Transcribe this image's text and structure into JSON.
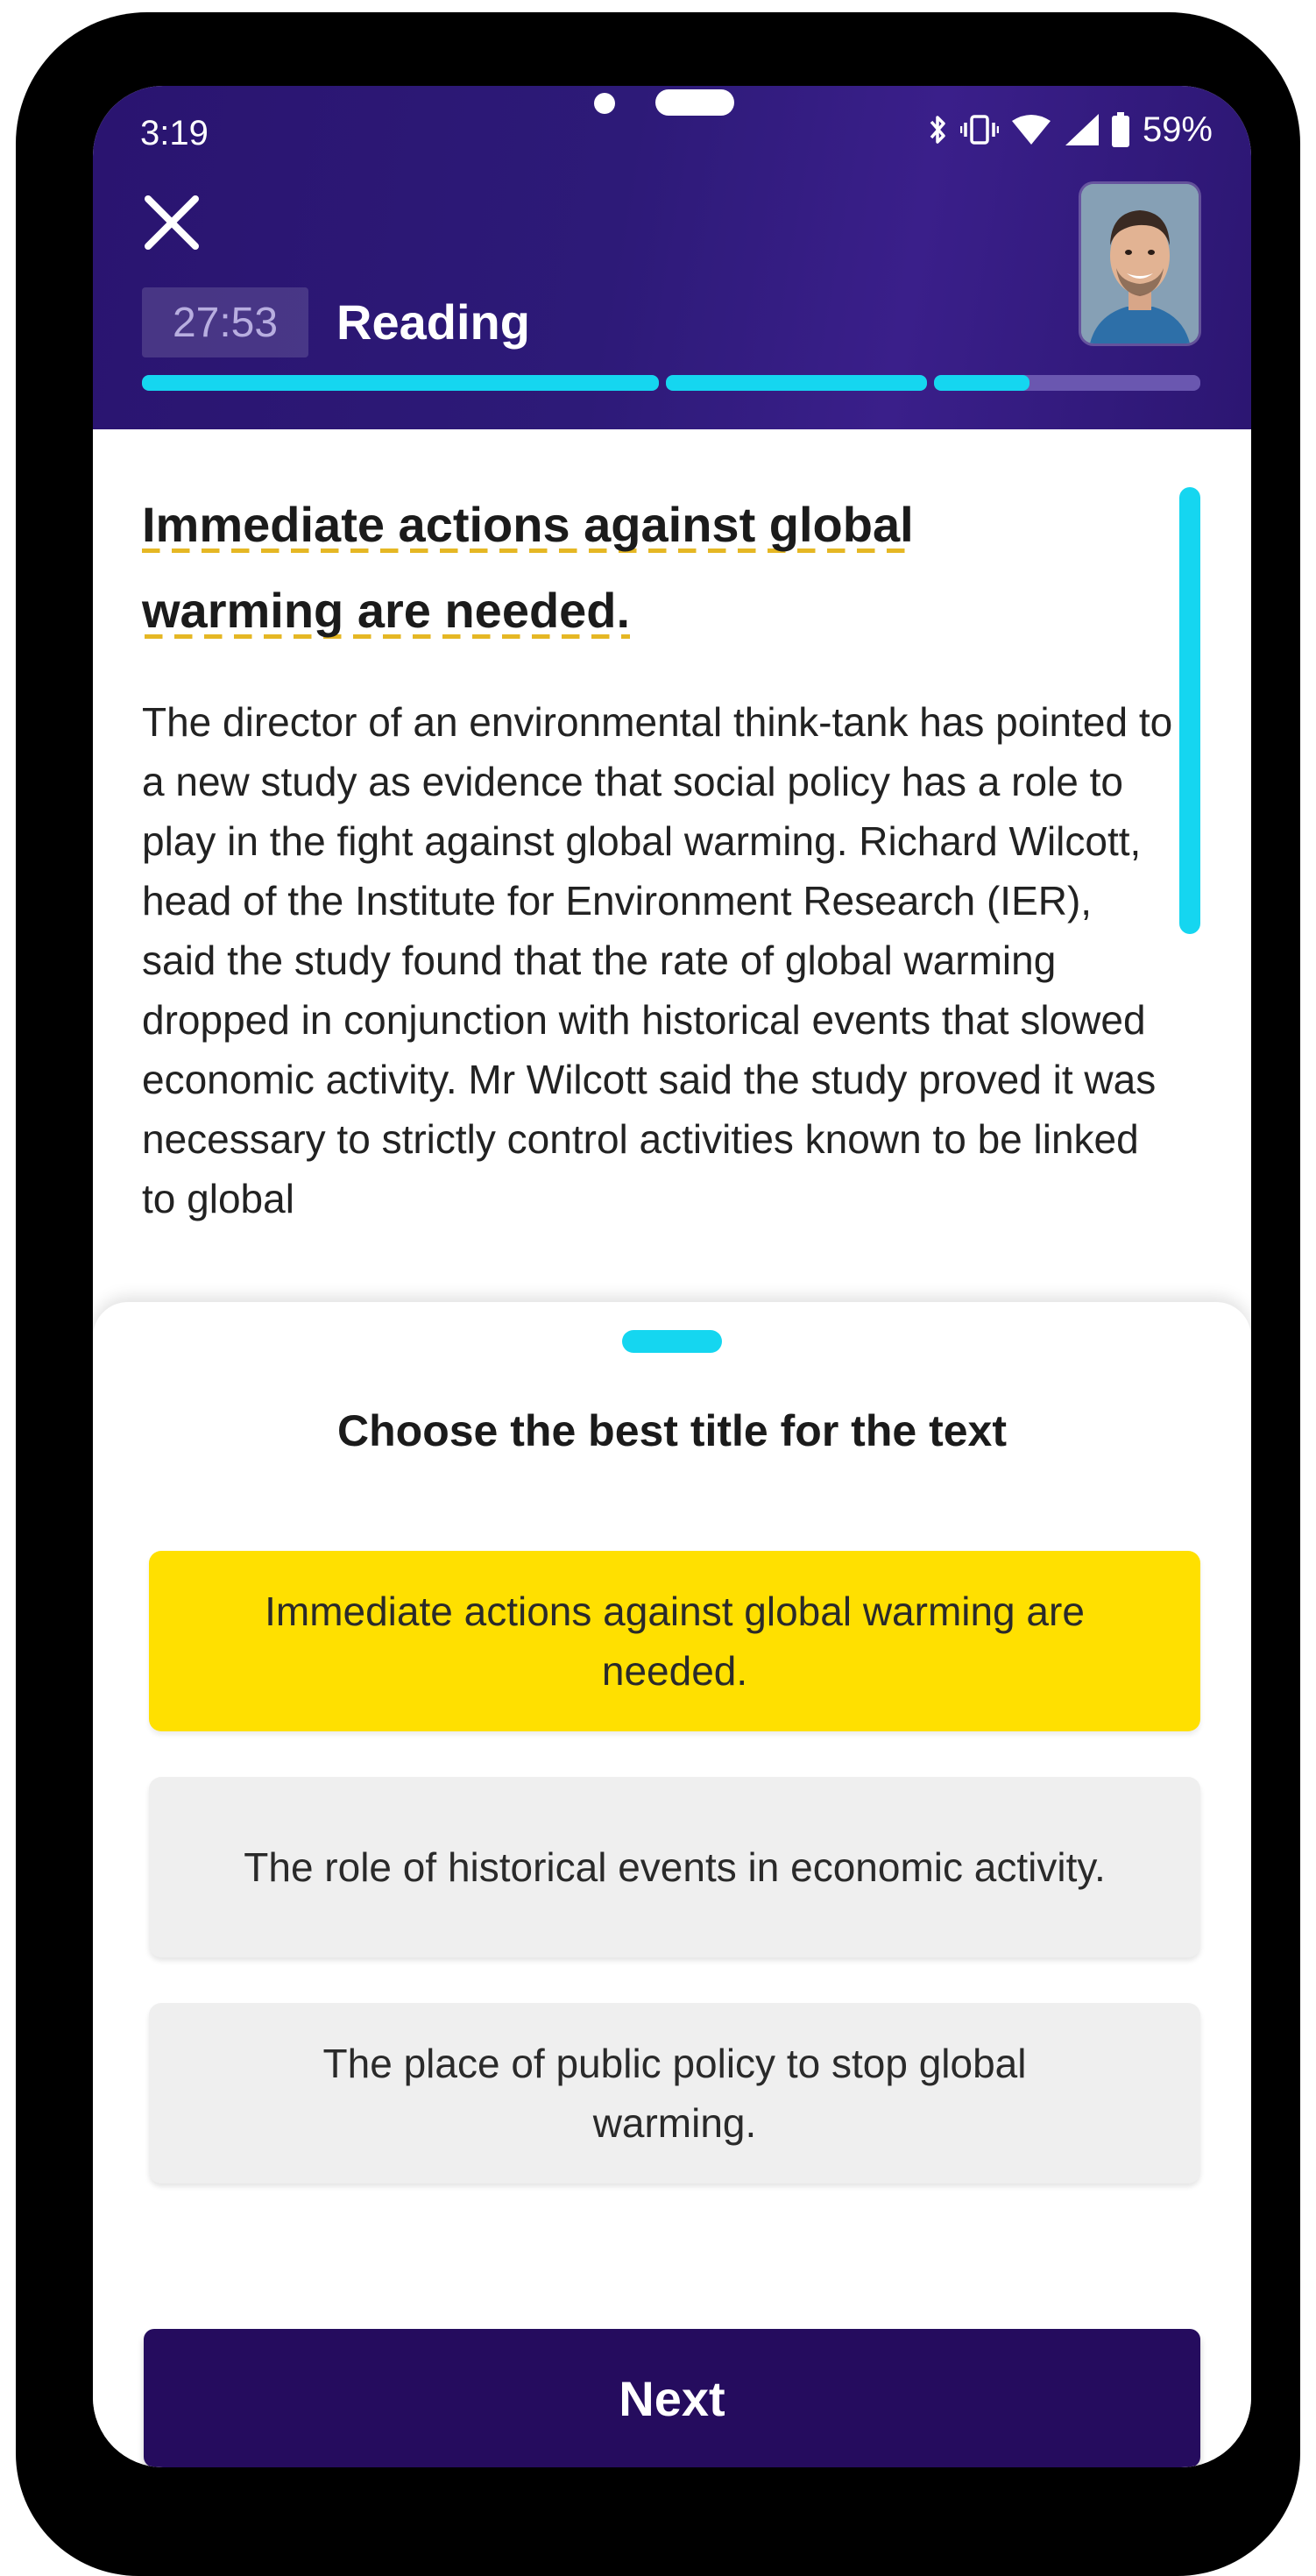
{
  "status_bar": {
    "time": "3:19",
    "battery_percent": "59%",
    "icons": [
      "bluetooth-icon",
      "vibrate-icon",
      "wifi-icon",
      "cell-signal-icon",
      "battery-icon"
    ]
  },
  "header": {
    "timer": "27:53",
    "section_title": "Reading",
    "close_icon": "close-icon",
    "progress_segments": [
      1.0,
      1.0,
      0.36
    ]
  },
  "article": {
    "title": "Immediate actions against global warming are needed.",
    "body": "The director of an environmental think-tank has pointed to a new study as evidence that social policy has a role to play in the fight against global warming. Richard Wilcott, head of the Institute for Environment Research (IER), said the study found that the rate of global warming dropped in conjunction with historical events that slowed economic activity. Mr Wilcott said the study proved it was necessary to strictly control activities known to be linked to global"
  },
  "question": {
    "prompt": "Choose the best title for the text",
    "options": [
      {
        "label": "Immediate actions against global warming are needed.",
        "selected": true
      },
      {
        "label": "The role of historical events in economic activity.",
        "selected": false
      },
      {
        "label": "The place of public policy to stop global warming.",
        "selected": false
      }
    ],
    "next_label": "Next"
  },
  "colors": {
    "header_bg": "#2a1470",
    "accent_cyan": "#15d6f0",
    "selected_option": "#ffe000",
    "next_button": "#250c5e",
    "title_underline": "#e5b724"
  }
}
